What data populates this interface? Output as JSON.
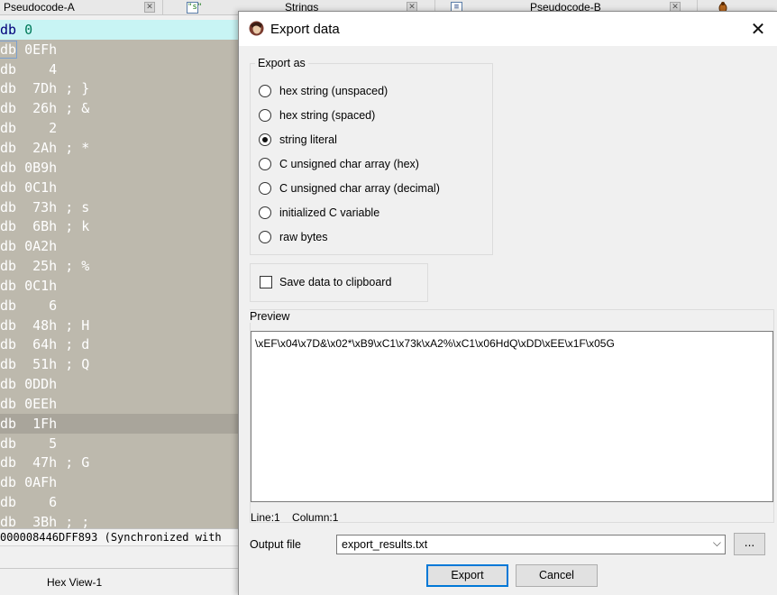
{
  "tabs": {
    "pseudocode_a": "Pseudocode-A",
    "strings": "Strings",
    "strings_icon": "\"s\"",
    "pseudocode_b": "Pseudocode-B",
    "close_glyph": "✕"
  },
  "listing": {
    "rows": [
      {
        "kw": "db",
        "val": " 0",
        "cmt": ""
      },
      {
        "kw": "db",
        "val": " 0EFh",
        "cmt": ""
      },
      {
        "kw": "db",
        "val": "    4",
        "cmt": ""
      },
      {
        "kw": "db",
        "val": "  7Dh",
        "cmt": " ; }"
      },
      {
        "kw": "db",
        "val": "  26h",
        "cmt": " ; &"
      },
      {
        "kw": "db",
        "val": "    2",
        "cmt": ""
      },
      {
        "kw": "db",
        "val": "  2Ah",
        "cmt": " ; *"
      },
      {
        "kw": "db",
        "val": " 0B9h",
        "cmt": ""
      },
      {
        "kw": "db",
        "val": " 0C1h",
        "cmt": ""
      },
      {
        "kw": "db",
        "val": "  73h",
        "cmt": " ; s"
      },
      {
        "kw": "db",
        "val": "  6Bh",
        "cmt": " ; k"
      },
      {
        "kw": "db",
        "val": " 0A2h",
        "cmt": ""
      },
      {
        "kw": "db",
        "val": "  25h",
        "cmt": " ; %"
      },
      {
        "kw": "db",
        "val": " 0C1h",
        "cmt": ""
      },
      {
        "kw": "db",
        "val": "    6",
        "cmt": ""
      },
      {
        "kw": "db",
        "val": "  48h",
        "cmt": " ; H"
      },
      {
        "kw": "db",
        "val": "  64h",
        "cmt": " ; d"
      },
      {
        "kw": "db",
        "val": "  51h",
        "cmt": " ; Q"
      },
      {
        "kw": "db",
        "val": " 0DDh",
        "cmt": ""
      },
      {
        "kw": "db",
        "val": " 0EEh",
        "cmt": ""
      },
      {
        "kw": "db",
        "val": "  1Fh",
        "cmt": ""
      },
      {
        "kw": "db",
        "val": "    5",
        "cmt": ""
      },
      {
        "kw": "db",
        "val": "  47h",
        "cmt": " ; G"
      },
      {
        "kw": "db",
        "val": " 0AFh",
        "cmt": ""
      },
      {
        "kw": "db",
        "val": "    6",
        "cmt": ""
      },
      {
        "kw": "db",
        "val": "  3Bh",
        "cmt": " ; ;"
      }
    ],
    "status": "000008446DFF893 (Synchronized with",
    "bottom_tab": "Hex View-1"
  },
  "dialog": {
    "title": "Export data",
    "close_glyph": "✕",
    "export_as_label": "Export as",
    "options": [
      {
        "label": "hex string (unspaced)",
        "selected": false
      },
      {
        "label": "hex string (spaced)",
        "selected": false
      },
      {
        "label": "string literal",
        "selected": true
      },
      {
        "label": "C unsigned char array (hex)",
        "selected": false
      },
      {
        "label": "C unsigned char array (decimal)",
        "selected": false
      },
      {
        "label": "initialized C variable",
        "selected": false
      },
      {
        "label": "raw bytes",
        "selected": false
      }
    ],
    "clipboard_label": "Save data to clipboard",
    "clipboard_checked": false,
    "preview_label": "Preview",
    "preview_text": "\\xEF\\x04\\x7D&\\x02*\\xB9\\xC1\\x73k\\xA2%\\xC1\\x06HdQ\\xDD\\xEE\\x1F\\x05G",
    "line_label": "Line:1",
    "column_label": "Column:1",
    "output_label": "Output file",
    "output_value": "export_results.txt",
    "combo_arrow": "⌵",
    "browse_label": "...",
    "export_button": "Export",
    "cancel_button": "Cancel"
  },
  "colors": {
    "listing_bg": "#bdb9ad",
    "selected_row": "#c8f4f4",
    "accent_focus": "#0078d7"
  }
}
